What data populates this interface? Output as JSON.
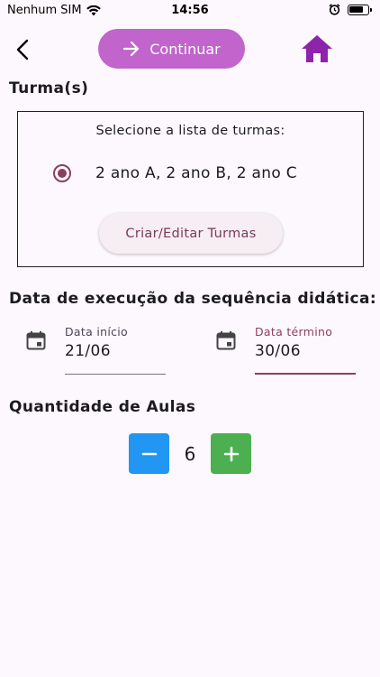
{
  "status_bar": {
    "carrier": "Nenhum SIM",
    "time": "14:56"
  },
  "header": {
    "continue_label": "Continuar"
  },
  "turmas": {
    "title": "Turma(s)",
    "prompt": "Selecione a lista de turmas:",
    "option_label": "2 ano A, 2 ano B, 2 ano C",
    "option_selected": true,
    "edit_button": "Criar/Editar Turmas"
  },
  "execution": {
    "title": "Data de execução da sequência didática:",
    "start": {
      "label": "Data início",
      "value": "21/06"
    },
    "end": {
      "label": "Data término",
      "value": "30/06"
    }
  },
  "lessons": {
    "title": "Quantidade de Aulas",
    "count": "6"
  },
  "colors": {
    "primary": "#c164cb",
    "accent": "#8c3f5c",
    "home_icon": "#8e24aa",
    "minus_button": "#2196f3",
    "plus_button": "#4caf50"
  },
  "icons": [
    "wifi-icon",
    "alarm-icon",
    "battery-icon",
    "back-arrow-icon",
    "arrow-right-icon",
    "home-icon",
    "calendar-icon",
    "minus-icon",
    "plus-icon"
  ]
}
